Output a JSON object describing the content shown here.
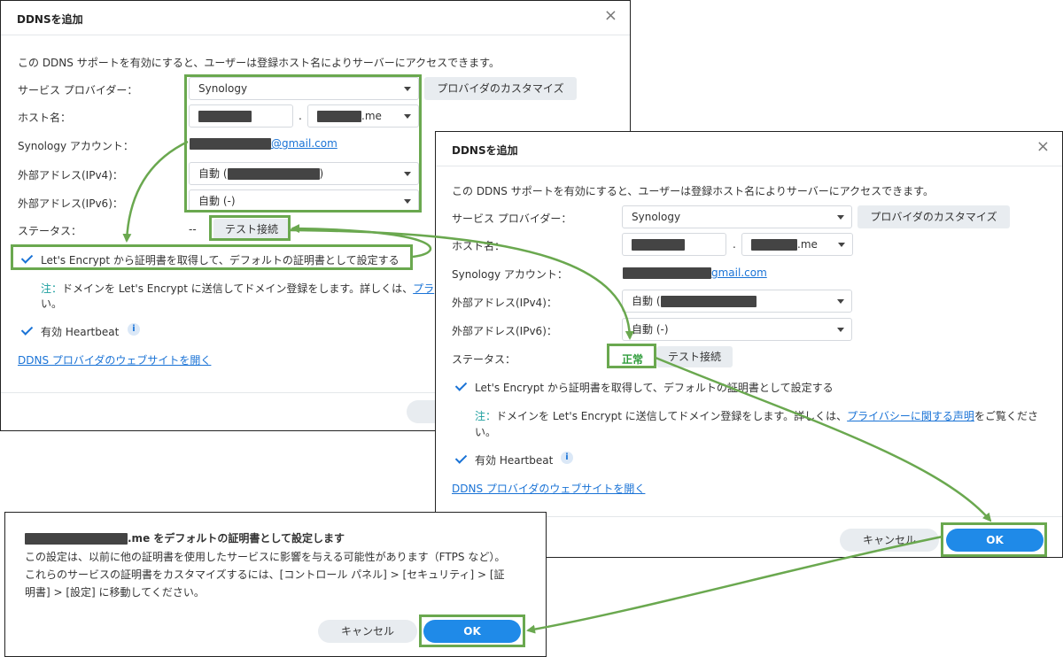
{
  "colors": {
    "accent": "#1f8ae8",
    "highlight": "#6aa84f",
    "status_ok": "#2e9c3a"
  },
  "dialog1": {
    "title": "DDNSを追加",
    "close": "×",
    "desc": "この DDNS サポートを有効にすると、ユーザーは登録ホスト名によりサーバーにアクセスできます。",
    "labels": {
      "provider": "サービス プロバイダー：",
      "hostname": "ホスト名：",
      "account": "Synology アカウント：",
      "ipv4": "外部アドレス(IPv4)：",
      "ipv6": "外部アドレス(IPv6)：",
      "status": "ステータス："
    },
    "provider_value": "Synology",
    "customize_button": "プロバイダのカスタマイズ",
    "host_dot": ".",
    "domain_suffix": ".me",
    "account_suffix": "@gmail.com",
    "ipv4_value": "自動 (",
    "ipv4_close": ")",
    "ipv6_value": "自動 (-)",
    "status_value": "--",
    "test_button": "テスト接続",
    "letsencrypt": "Let's Encrypt から証明書を取得して、デフォルトの証明書として設定する",
    "note_head": "注：",
    "note_body": "ドメインを Let's Encrypt に送信してドメイン登録をします。詳しくは、",
    "note_link": "プラ",
    "note_cont": "い。",
    "heartbeat": "有効 Heartbeat",
    "info": "i",
    "website_link": "DDNS プロバイダのウェブサイトを開く",
    "footer_btn": "キ"
  },
  "dialog2": {
    "title": "DDNSを追加",
    "close": "×",
    "desc": "この DDNS サポートを有効にすると、ユーザーは登録ホスト名によりサーバーにアクセスできます。",
    "labels": {
      "provider": "サービス プロバイダー：",
      "hostname": "ホスト名：",
      "account": "Synology アカウント：",
      "ipv4": "外部アドレス(IPv4)：",
      "ipv6": "外部アドレス(IPv6)：",
      "status": "ステータス："
    },
    "provider_value": "Synology",
    "customize_button": "プロバイダのカスタマイズ",
    "host_dot": ".",
    "domain_suffix": ".me",
    "account_suffix": "gmail.com",
    "ipv4_value": "自動 (",
    "ipv6_value": "自動 (-)",
    "status_value": "正常",
    "test_button": "テスト接続",
    "letsencrypt": "Let's Encrypt から証明書を取得して、デフォルトの証明書として設定する",
    "note_head": "注：",
    "note_body": "ドメインを Let's Encrypt に送信してドメイン登録をします。詳しくは、",
    "note_link": "プライバシーに関する声明",
    "note_tail": "をご覧くださ",
    "note_cont": "い。",
    "heartbeat": "有効 Heartbeat",
    "info": "i",
    "website_link": "DDNS プロバイダのウェブサイトを開く",
    "cancel": "キャンセル",
    "ok": "OK"
  },
  "dialog3": {
    "title_suffix": ".me をデフォルトの証明書として設定します",
    "body_line1": "この設定は、以前に他の証明書を使用したサービスに影響を与える可能性があります（FTPS など）。",
    "body_line2": "これらのサービスの証明書をカスタマイズするには、[コントロール パネル] > [セキュリティ] > [証",
    "body_line3": "明書] > [設定] に移動してください。",
    "cancel": "キャンセル",
    "ok": "OK"
  }
}
